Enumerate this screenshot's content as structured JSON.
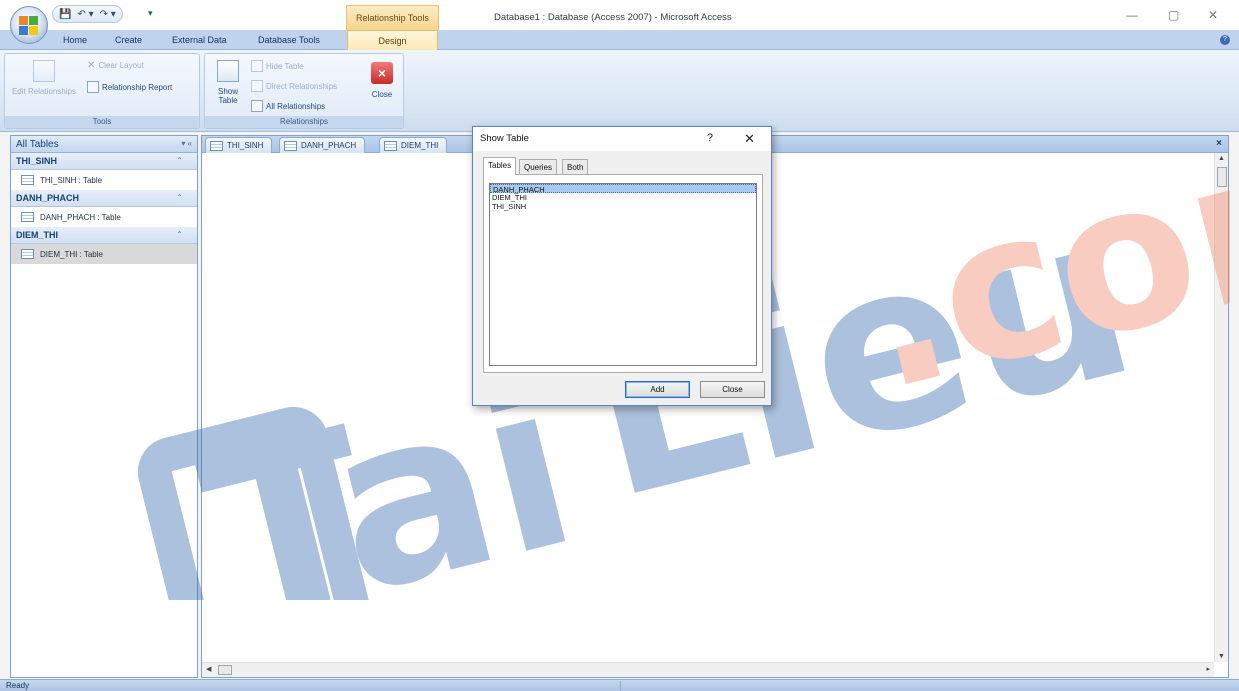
{
  "window": {
    "title": "Database1 : Database (Access 2007) - Microsoft Access",
    "contextual_group": "Relationship Tools",
    "controls": {
      "minimize": "—",
      "restore": "▢",
      "close": "✕"
    }
  },
  "quick_access": {
    "save": "💾",
    "undo": "↶ ▾",
    "redo": "↷ ▾",
    "more": "▾"
  },
  "ribbon_tabs": {
    "home": "Home",
    "create": "Create",
    "external_data": "External Data",
    "database_tools": "Database Tools",
    "design": "Design",
    "help": "?"
  },
  "ribbon": {
    "tools_group": {
      "label": "Tools",
      "edit_relationships": "Edit Relationships",
      "clear_layout": "Clear Layout",
      "relationship_report": "Relationship Report"
    },
    "relationships_group": {
      "label": "Relationships",
      "show_table": "Show Table",
      "hide_table": "Hide Table",
      "direct_relationships": "Direct Relationships",
      "all_relationships": "All Relationships",
      "close": "Close"
    }
  },
  "nav_pane": {
    "header": "All Tables",
    "header_buttons": "▾ «",
    "groups": [
      {
        "name": "THI_SINH",
        "chevron": "⌃",
        "item": "THI_SINH : Table"
      },
      {
        "name": "DANH_PHACH",
        "chevron": "⌃",
        "item": "DANH_PHACH : Table"
      },
      {
        "name": "DIEM_THI",
        "chevron": "⌃",
        "item": "DIEM_THI : Table"
      }
    ]
  },
  "document_tabs": [
    "THI_SINH",
    "DANH_PHACH",
    "DIEM_THI"
  ],
  "document_close": "×",
  "scroll": {
    "up": "▲",
    "down": "▼",
    "left": "◀",
    "right": "▸"
  },
  "dialog": {
    "title": "Show Table",
    "help": "?",
    "close": "✕",
    "tabs": [
      "Tables",
      "Queries",
      "Both"
    ],
    "list_items": [
      "DANH_PHACH",
      "DIEM_THI",
      "THI_SINH"
    ],
    "selected_item": "DANH_PHACH",
    "add_button": "Add",
    "close_button": "Close"
  },
  "watermark": {
    "text_part1": "Tai",
    "text_part2": "Lieu",
    "text_part3": ".com",
    "color_blue": "#3b6db0",
    "color_orange": "#f0886b"
  },
  "status": {
    "text": "Ready"
  },
  "colors": {
    "ribbon_blue": "#bfd3ee",
    "contextual_orange": "#f6d58c",
    "accent": "#2a6bd1"
  }
}
